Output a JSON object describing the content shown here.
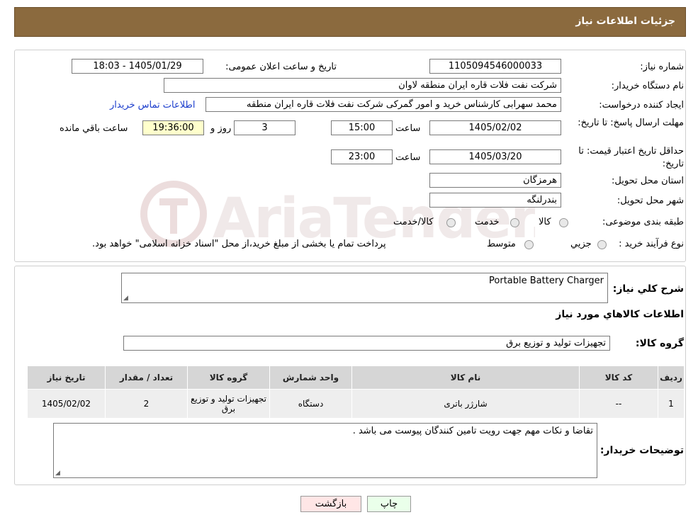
{
  "header": {
    "title": "جزئیات اطلاعات نیاز"
  },
  "form": {
    "need_number_label": "شماره نیاز:",
    "need_number": "1105094546000033",
    "announce_label": "تاریخ و ساعت اعلان عمومی:",
    "announce_value": "1405/01/29 - 18:03",
    "buyer_org_label": "نام دستگاه خریدار:",
    "buyer_org": "شرکت نفت فلات قاره ایران منطقه لاوان",
    "creator_label": "ایجاد کننده درخواست:",
    "creator": "محمد سهرابی کارشناس خرید و امور گمرکی شرکت نفت فلات قاره ایران منطقه",
    "contact_link": "اطلاعات تماس خریدار",
    "reply_deadline_label": "مهلت ارسال پاسخ: تا تاریخ:",
    "reply_date": "1405/02/02",
    "time_label": "ساعت",
    "reply_time": "15:00",
    "days_value": "3",
    "days_label": "روز و",
    "remaining_time": "19:36:00",
    "remaining_label": "ساعت باقي مانده",
    "price_validity_label": "حداقل تاریخ اعتبار قیمت: تا تاریخ:",
    "price_date": "1405/03/20",
    "price_time": "23:00",
    "province_label": "استان محل تحویل:",
    "province": "هرمزگان",
    "city_label": "شهر محل تحویل:",
    "city": "بندرلنگه",
    "category_label": "طبقه بندی موضوعی:",
    "category_options": [
      "کالا",
      "خدمت",
      "کالا/خدمت"
    ],
    "purchase_type_label": "نوع فرآیند خرید :",
    "purchase_options": [
      "جزيي",
      "متوسط"
    ],
    "purchase_note": "پرداخت تمام یا بخشی از مبلغ خرید،از محل \"اسناد خزانه اسلامی\" خواهد بود."
  },
  "watermark": {
    "text": "AriaTender.neT"
  },
  "details": {
    "summary_label": "شرح کلي نياز:",
    "summary_value": "Portable Battery Charger",
    "items_title": "اطلاعات کالاهاي مورد نياز",
    "group_label": "گروه کالا:",
    "group_value": "تجهیزات تولید و توزیع برق",
    "table": {
      "headers": [
        "رديف",
        "کد کالا",
        "نام کالا",
        "واحد شمارش",
        "گروه کالا",
        "تعداد / مقدار",
        "تاریخ نیاز"
      ],
      "rows": [
        [
          "1",
          "--",
          "شارژر باتری",
          "دستگاه",
          "تجهیزات تولید و توزیع برق",
          "2",
          "1405/02/02"
        ]
      ]
    },
    "buyer_notes_label": "توضيحات خريدار:",
    "buyer_notes_value": "تقاضا و نکات مهم جهت رویت تامین کنندگان پیوست می باشد ."
  },
  "buttons": {
    "print": "چاپ",
    "back": "بازگشت"
  }
}
